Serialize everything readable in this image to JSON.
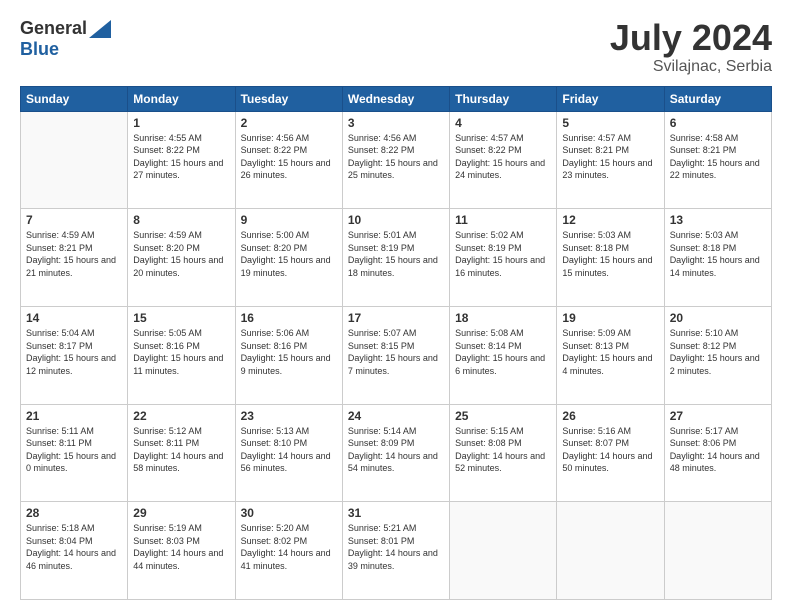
{
  "logo": {
    "general": "General",
    "blue": "Blue"
  },
  "title": {
    "month": "July 2024",
    "location": "Svilajnac, Serbia"
  },
  "days_of_week": [
    "Sunday",
    "Monday",
    "Tuesday",
    "Wednesday",
    "Thursday",
    "Friday",
    "Saturday"
  ],
  "weeks": [
    [
      {
        "day": "",
        "sunrise": "",
        "sunset": "",
        "daylight": "",
        "empty": true
      },
      {
        "day": "1",
        "sunrise": "Sunrise: 4:55 AM",
        "sunset": "Sunset: 8:22 PM",
        "daylight": "Daylight: 15 hours and 27 minutes."
      },
      {
        "day": "2",
        "sunrise": "Sunrise: 4:56 AM",
        "sunset": "Sunset: 8:22 PM",
        "daylight": "Daylight: 15 hours and 26 minutes."
      },
      {
        "day": "3",
        "sunrise": "Sunrise: 4:56 AM",
        "sunset": "Sunset: 8:22 PM",
        "daylight": "Daylight: 15 hours and 25 minutes."
      },
      {
        "day": "4",
        "sunrise": "Sunrise: 4:57 AM",
        "sunset": "Sunset: 8:22 PM",
        "daylight": "Daylight: 15 hours and 24 minutes."
      },
      {
        "day": "5",
        "sunrise": "Sunrise: 4:57 AM",
        "sunset": "Sunset: 8:21 PM",
        "daylight": "Daylight: 15 hours and 23 minutes."
      },
      {
        "day": "6",
        "sunrise": "Sunrise: 4:58 AM",
        "sunset": "Sunset: 8:21 PM",
        "daylight": "Daylight: 15 hours and 22 minutes."
      }
    ],
    [
      {
        "day": "7",
        "sunrise": "Sunrise: 4:59 AM",
        "sunset": "Sunset: 8:21 PM",
        "daylight": "Daylight: 15 hours and 21 minutes."
      },
      {
        "day": "8",
        "sunrise": "Sunrise: 4:59 AM",
        "sunset": "Sunset: 8:20 PM",
        "daylight": "Daylight: 15 hours and 20 minutes."
      },
      {
        "day": "9",
        "sunrise": "Sunrise: 5:00 AM",
        "sunset": "Sunset: 8:20 PM",
        "daylight": "Daylight: 15 hours and 19 minutes."
      },
      {
        "day": "10",
        "sunrise": "Sunrise: 5:01 AM",
        "sunset": "Sunset: 8:19 PM",
        "daylight": "Daylight: 15 hours and 18 minutes."
      },
      {
        "day": "11",
        "sunrise": "Sunrise: 5:02 AM",
        "sunset": "Sunset: 8:19 PM",
        "daylight": "Daylight: 15 hours and 16 minutes."
      },
      {
        "day": "12",
        "sunrise": "Sunrise: 5:03 AM",
        "sunset": "Sunset: 8:18 PM",
        "daylight": "Daylight: 15 hours and 15 minutes."
      },
      {
        "day": "13",
        "sunrise": "Sunrise: 5:03 AM",
        "sunset": "Sunset: 8:18 PM",
        "daylight": "Daylight: 15 hours and 14 minutes."
      }
    ],
    [
      {
        "day": "14",
        "sunrise": "Sunrise: 5:04 AM",
        "sunset": "Sunset: 8:17 PM",
        "daylight": "Daylight: 15 hours and 12 minutes."
      },
      {
        "day": "15",
        "sunrise": "Sunrise: 5:05 AM",
        "sunset": "Sunset: 8:16 PM",
        "daylight": "Daylight: 15 hours and 11 minutes."
      },
      {
        "day": "16",
        "sunrise": "Sunrise: 5:06 AM",
        "sunset": "Sunset: 8:16 PM",
        "daylight": "Daylight: 15 hours and 9 minutes."
      },
      {
        "day": "17",
        "sunrise": "Sunrise: 5:07 AM",
        "sunset": "Sunset: 8:15 PM",
        "daylight": "Daylight: 15 hours and 7 minutes."
      },
      {
        "day": "18",
        "sunrise": "Sunrise: 5:08 AM",
        "sunset": "Sunset: 8:14 PM",
        "daylight": "Daylight: 15 hours and 6 minutes."
      },
      {
        "day": "19",
        "sunrise": "Sunrise: 5:09 AM",
        "sunset": "Sunset: 8:13 PM",
        "daylight": "Daylight: 15 hours and 4 minutes."
      },
      {
        "day": "20",
        "sunrise": "Sunrise: 5:10 AM",
        "sunset": "Sunset: 8:12 PM",
        "daylight": "Daylight: 15 hours and 2 minutes."
      }
    ],
    [
      {
        "day": "21",
        "sunrise": "Sunrise: 5:11 AM",
        "sunset": "Sunset: 8:11 PM",
        "daylight": "Daylight: 15 hours and 0 minutes."
      },
      {
        "day": "22",
        "sunrise": "Sunrise: 5:12 AM",
        "sunset": "Sunset: 8:11 PM",
        "daylight": "Daylight: 14 hours and 58 minutes."
      },
      {
        "day": "23",
        "sunrise": "Sunrise: 5:13 AM",
        "sunset": "Sunset: 8:10 PM",
        "daylight": "Daylight: 14 hours and 56 minutes."
      },
      {
        "day": "24",
        "sunrise": "Sunrise: 5:14 AM",
        "sunset": "Sunset: 8:09 PM",
        "daylight": "Daylight: 14 hours and 54 minutes."
      },
      {
        "day": "25",
        "sunrise": "Sunrise: 5:15 AM",
        "sunset": "Sunset: 8:08 PM",
        "daylight": "Daylight: 14 hours and 52 minutes."
      },
      {
        "day": "26",
        "sunrise": "Sunrise: 5:16 AM",
        "sunset": "Sunset: 8:07 PM",
        "daylight": "Daylight: 14 hours and 50 minutes."
      },
      {
        "day": "27",
        "sunrise": "Sunrise: 5:17 AM",
        "sunset": "Sunset: 8:06 PM",
        "daylight": "Daylight: 14 hours and 48 minutes."
      }
    ],
    [
      {
        "day": "28",
        "sunrise": "Sunrise: 5:18 AM",
        "sunset": "Sunset: 8:04 PM",
        "daylight": "Daylight: 14 hours and 46 minutes."
      },
      {
        "day": "29",
        "sunrise": "Sunrise: 5:19 AM",
        "sunset": "Sunset: 8:03 PM",
        "daylight": "Daylight: 14 hours and 44 minutes."
      },
      {
        "day": "30",
        "sunrise": "Sunrise: 5:20 AM",
        "sunset": "Sunset: 8:02 PM",
        "daylight": "Daylight: 14 hours and 41 minutes."
      },
      {
        "day": "31",
        "sunrise": "Sunrise: 5:21 AM",
        "sunset": "Sunset: 8:01 PM",
        "daylight": "Daylight: 14 hours and 39 minutes."
      },
      {
        "day": "",
        "sunrise": "",
        "sunset": "",
        "daylight": "",
        "empty": true
      },
      {
        "day": "",
        "sunrise": "",
        "sunset": "",
        "daylight": "",
        "empty": true
      },
      {
        "day": "",
        "sunrise": "",
        "sunset": "",
        "daylight": "",
        "empty": true
      }
    ]
  ]
}
